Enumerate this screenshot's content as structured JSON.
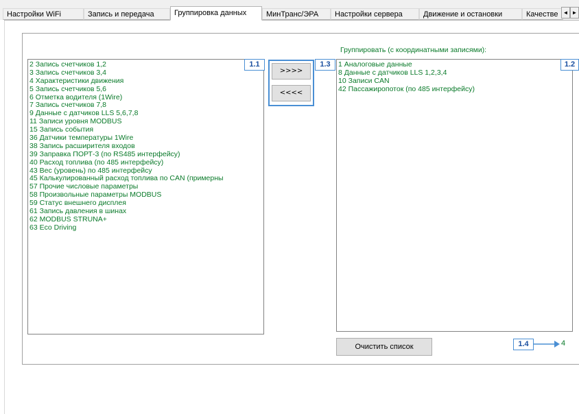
{
  "tabs": [
    {
      "label": "Настройки WiFi",
      "active": false
    },
    {
      "label": "Запись и передача",
      "active": false
    },
    {
      "label": "Группировка данных",
      "active": true
    },
    {
      "label": "МинТранс/ЭРА",
      "active": false
    },
    {
      "label": "Настройки сервера",
      "active": false
    },
    {
      "label": "Движение и остановки",
      "active": false
    },
    {
      "label": "Качестве",
      "active": false
    }
  ],
  "tab_scroll": {
    "left": "◄",
    "right": "►"
  },
  "left_list": {
    "items": [
      "2 Запись счетчиков 1,2",
      "3 Запись счетчиков 3,4",
      "4 Характеристики движения",
      "5 Запись счетчиков 5,6",
      "6 Отметка водителя (1Wire)",
      "7 Запись счетчиков 7,8",
      "9 Данные с датчиков LLS 5,6,7,8",
      "11 Записи уровня MODBUS",
      "15 Запись события",
      "36 Датчики температуры 1Wire",
      "38 Запись расширителя входов",
      "39 Заправка ПОРТ-3 (по RS485 интерфейсу)",
      "40 Расход топлива (по 485 интерфейсу)",
      "43 Вес (уровень) по 485 интерфейсу",
      "45 Калькулированный расход топлива по CAN (примерны",
      "57 Прочие числовые параметры",
      "58 Произвольные параметры MODBUS",
      "59 Статус внешнего дисплея",
      "61 Запись давления в шинах",
      "62 MODBUS STRUNA+",
      "63 Eco Driving"
    ]
  },
  "buttons": {
    "add": ">>>>",
    "remove": "<<<<",
    "clear": "Очистить список"
  },
  "right_list": {
    "label": "Группировать (с координатными записями):",
    "items": [
      "1 Аналоговые данные",
      "8 Данные с датчиков LLS 1,2,3,4",
      "10 Записи CAN",
      "42 Пассажиропоток (по 485 интерфейсу)"
    ]
  },
  "count": "4",
  "markers": {
    "m1": "1.1",
    "m2": "1.2",
    "m3": "1.3",
    "m4": "1.4"
  },
  "colors": {
    "item_text": "#0a7a2a",
    "marker_border": "#4a8fd4"
  }
}
